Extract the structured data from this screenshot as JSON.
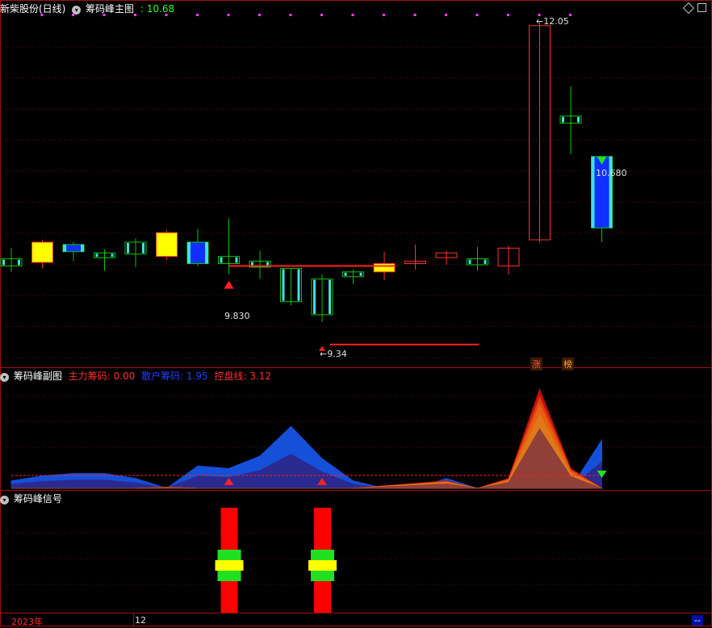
{
  "header": {
    "stock_name": "新柴股份(日线)",
    "main_indicator": "筹码峰主图",
    "main_value": ": 10.68",
    "sub_indicator": "筹码峰副图",
    "sub_items": [
      {
        "label": "主力筹码: 0.00",
        "color": "#ff3030"
      },
      {
        "label": "散户筹码: 1.95",
        "color": "#2040ff"
      },
      {
        "label": "控盘线: 3.12",
        "color": "#ff3030"
      }
    ],
    "signal_indicator": "筹码峰信号"
  },
  "badges": {
    "rise": "涨",
    "list": "榜"
  },
  "axis": {
    "year_label": "2023年",
    "month_label": "12",
    "corner_label": "--"
  },
  "annotations": {
    "high": "12.05",
    "low": "9.34",
    "peak_low": "9.830",
    "last": "10.680"
  },
  "colors": {
    "up": "#ff3030",
    "down": "#40e0e0",
    "yellow": "#ffff00",
    "blue": "#1030ff",
    "green": "#00c800"
  },
  "chart_data": {
    "type": "candlestick",
    "price_range": [
      9.25,
      12.1
    ],
    "candles": [
      {
        "open": 10.0,
        "close": 10.06,
        "high": 10.15,
        "low": 9.95,
        "style": "green"
      },
      {
        "open": 10.03,
        "close": 10.2,
        "high": 10.22,
        "low": 9.98,
        "style": "yellow"
      },
      {
        "open": 10.12,
        "close": 10.18,
        "high": 10.2,
        "low": 10.04,
        "style": "blue"
      },
      {
        "open": 10.07,
        "close": 10.11,
        "high": 10.14,
        "low": 9.96,
        "style": "green"
      },
      {
        "open": 10.1,
        "close": 10.2,
        "high": 10.23,
        "low": 9.99,
        "style": "cyan"
      },
      {
        "open": 10.08,
        "close": 10.28,
        "high": 10.3,
        "low": 10.05,
        "style": "yellow"
      },
      {
        "open": 10.2,
        "close": 10.02,
        "high": 10.31,
        "low": 10.0,
        "style": "blue"
      },
      {
        "open": 10.02,
        "close": 10.08,
        "high": 10.4,
        "low": 9.93,
        "style": "green"
      },
      {
        "open": 10.04,
        "close": 9.99,
        "high": 10.13,
        "low": 9.89,
        "style": "cyan"
      },
      {
        "open": 9.98,
        "close": 9.7,
        "high": 9.98,
        "low": 9.67,
        "style": "cyan"
      },
      {
        "open": 9.89,
        "close": 9.59,
        "high": 9.93,
        "low": 9.53,
        "style": "green"
      },
      {
        "open": 9.91,
        "close": 9.95,
        "high": 9.97,
        "low": 9.85,
        "style": "green"
      },
      {
        "open": 10.02,
        "close": 9.95,
        "high": 10.12,
        "low": 9.88,
        "style": "yellow"
      },
      {
        "open": 10.02,
        "close": 10.04,
        "high": 10.18,
        "low": 9.97,
        "style": "redline"
      },
      {
        "open": 10.07,
        "close": 10.11,
        "high": 10.13,
        "low": 10.01,
        "style": "red"
      },
      {
        "open": 10.06,
        "close": 10.01,
        "high": 10.16,
        "low": 9.96,
        "style": "cyan"
      },
      {
        "open": 10.0,
        "close": 10.15,
        "high": 10.17,
        "low": 9.93,
        "style": "red"
      },
      {
        "open": 10.22,
        "close": 12.02,
        "high": 12.05,
        "low": 10.2,
        "style": "red"
      },
      {
        "open": 11.26,
        "close": 11.2,
        "high": 11.51,
        "low": 10.94,
        "style": "cyan"
      },
      {
        "open": 10.92,
        "close": 10.32,
        "high": 10.92,
        "low": 10.2,
        "style": "blue"
      }
    ],
    "sub_series": {
      "main_chips": [
        0,
        0,
        0,
        0,
        0,
        0.05,
        0,
        0,
        0,
        0,
        0,
        0,
        0.1,
        0.2,
        0.3,
        0,
        0.4,
        4.0,
        0.8,
        0
      ],
      "retail_chips": [
        0.3,
        0.5,
        0.6,
        0.6,
        0.4,
        0,
        0.9,
        0.8,
        1.3,
        2.5,
        1.2,
        0.3,
        0,
        0,
        0.4,
        0,
        0,
        0,
        0,
        1.95
      ],
      "control_line": 3.12
    },
    "signals": [
      7,
      10
    ]
  }
}
